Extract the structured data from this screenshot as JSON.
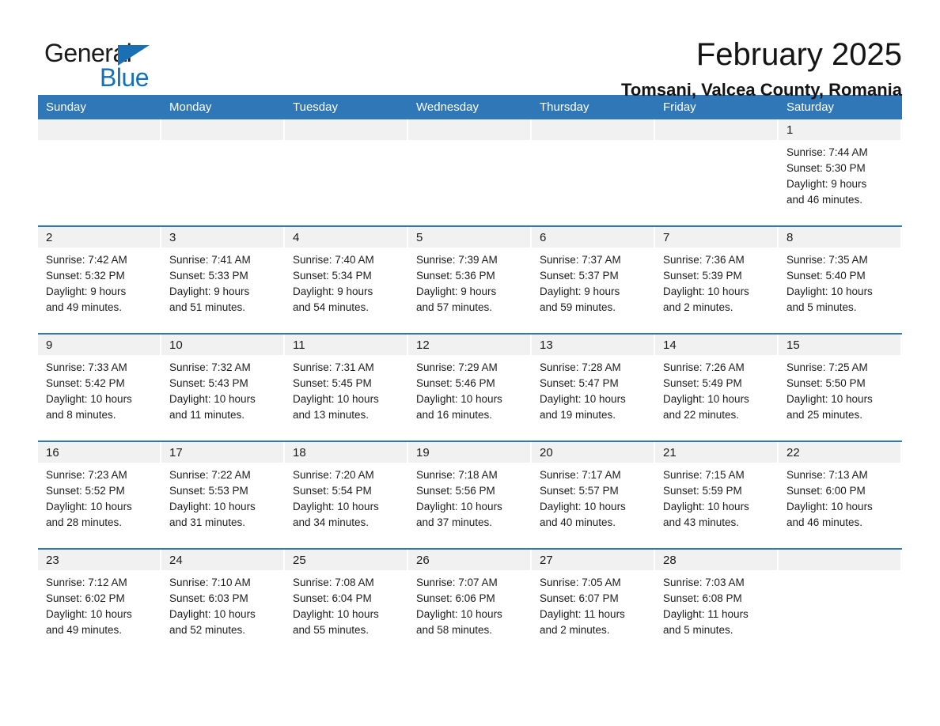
{
  "brand": {
    "name_part1": "General",
    "name_part2": "Blue",
    "triangle_icon": "triangle-icon",
    "accent_color": "#1570B8"
  },
  "header": {
    "title": "February 2025",
    "subtitle": "Tomsani, Valcea County, Romania"
  },
  "colors": {
    "header_blue": "#3077B8",
    "daynum_band": "#F1F1F1",
    "row_divider": "#3077B8"
  },
  "weekday_headers": [
    "Sunday",
    "Monday",
    "Tuesday",
    "Wednesday",
    "Thursday",
    "Friday",
    "Saturday"
  ],
  "weeks": [
    [
      {
        "day": "",
        "sunrise": "",
        "sunset": "",
        "daylight_line1": "",
        "daylight_line2": ""
      },
      {
        "day": "",
        "sunrise": "",
        "sunset": "",
        "daylight_line1": "",
        "daylight_line2": ""
      },
      {
        "day": "",
        "sunrise": "",
        "sunset": "",
        "daylight_line1": "",
        "daylight_line2": ""
      },
      {
        "day": "",
        "sunrise": "",
        "sunset": "",
        "daylight_line1": "",
        "daylight_line2": ""
      },
      {
        "day": "",
        "sunrise": "",
        "sunset": "",
        "daylight_line1": "",
        "daylight_line2": ""
      },
      {
        "day": "",
        "sunrise": "",
        "sunset": "",
        "daylight_line1": "",
        "daylight_line2": ""
      },
      {
        "day": "1",
        "sunrise": "Sunrise: 7:44 AM",
        "sunset": "Sunset: 5:30 PM",
        "daylight_line1": "Daylight: 9 hours",
        "daylight_line2": "and 46 minutes."
      }
    ],
    [
      {
        "day": "2",
        "sunrise": "Sunrise: 7:42 AM",
        "sunset": "Sunset: 5:32 PM",
        "daylight_line1": "Daylight: 9 hours",
        "daylight_line2": "and 49 minutes."
      },
      {
        "day": "3",
        "sunrise": "Sunrise: 7:41 AM",
        "sunset": "Sunset: 5:33 PM",
        "daylight_line1": "Daylight: 9 hours",
        "daylight_line2": "and 51 minutes."
      },
      {
        "day": "4",
        "sunrise": "Sunrise: 7:40 AM",
        "sunset": "Sunset: 5:34 PM",
        "daylight_line1": "Daylight: 9 hours",
        "daylight_line2": "and 54 minutes."
      },
      {
        "day": "5",
        "sunrise": "Sunrise: 7:39 AM",
        "sunset": "Sunset: 5:36 PM",
        "daylight_line1": "Daylight: 9 hours",
        "daylight_line2": "and 57 minutes."
      },
      {
        "day": "6",
        "sunrise": "Sunrise: 7:37 AM",
        "sunset": "Sunset: 5:37 PM",
        "daylight_line1": "Daylight: 9 hours",
        "daylight_line2": "and 59 minutes."
      },
      {
        "day": "7",
        "sunrise": "Sunrise: 7:36 AM",
        "sunset": "Sunset: 5:39 PM",
        "daylight_line1": "Daylight: 10 hours",
        "daylight_line2": "and 2 minutes."
      },
      {
        "day": "8",
        "sunrise": "Sunrise: 7:35 AM",
        "sunset": "Sunset: 5:40 PM",
        "daylight_line1": "Daylight: 10 hours",
        "daylight_line2": "and 5 minutes."
      }
    ],
    [
      {
        "day": "9",
        "sunrise": "Sunrise: 7:33 AM",
        "sunset": "Sunset: 5:42 PM",
        "daylight_line1": "Daylight: 10 hours",
        "daylight_line2": "and 8 minutes."
      },
      {
        "day": "10",
        "sunrise": "Sunrise: 7:32 AM",
        "sunset": "Sunset: 5:43 PM",
        "daylight_line1": "Daylight: 10 hours",
        "daylight_line2": "and 11 minutes."
      },
      {
        "day": "11",
        "sunrise": "Sunrise: 7:31 AM",
        "sunset": "Sunset: 5:45 PM",
        "daylight_line1": "Daylight: 10 hours",
        "daylight_line2": "and 13 minutes."
      },
      {
        "day": "12",
        "sunrise": "Sunrise: 7:29 AM",
        "sunset": "Sunset: 5:46 PM",
        "daylight_line1": "Daylight: 10 hours",
        "daylight_line2": "and 16 minutes."
      },
      {
        "day": "13",
        "sunrise": "Sunrise: 7:28 AM",
        "sunset": "Sunset: 5:47 PM",
        "daylight_line1": "Daylight: 10 hours",
        "daylight_line2": "and 19 minutes."
      },
      {
        "day": "14",
        "sunrise": "Sunrise: 7:26 AM",
        "sunset": "Sunset: 5:49 PM",
        "daylight_line1": "Daylight: 10 hours",
        "daylight_line2": "and 22 minutes."
      },
      {
        "day": "15",
        "sunrise": "Sunrise: 7:25 AM",
        "sunset": "Sunset: 5:50 PM",
        "daylight_line1": "Daylight: 10 hours",
        "daylight_line2": "and 25 minutes."
      }
    ],
    [
      {
        "day": "16",
        "sunrise": "Sunrise: 7:23 AM",
        "sunset": "Sunset: 5:52 PM",
        "daylight_line1": "Daylight: 10 hours",
        "daylight_line2": "and 28 minutes."
      },
      {
        "day": "17",
        "sunrise": "Sunrise: 7:22 AM",
        "sunset": "Sunset: 5:53 PM",
        "daylight_line1": "Daylight: 10 hours",
        "daylight_line2": "and 31 minutes."
      },
      {
        "day": "18",
        "sunrise": "Sunrise: 7:20 AM",
        "sunset": "Sunset: 5:54 PM",
        "daylight_line1": "Daylight: 10 hours",
        "daylight_line2": "and 34 minutes."
      },
      {
        "day": "19",
        "sunrise": "Sunrise: 7:18 AM",
        "sunset": "Sunset: 5:56 PM",
        "daylight_line1": "Daylight: 10 hours",
        "daylight_line2": "and 37 minutes."
      },
      {
        "day": "20",
        "sunrise": "Sunrise: 7:17 AM",
        "sunset": "Sunset: 5:57 PM",
        "daylight_line1": "Daylight: 10 hours",
        "daylight_line2": "and 40 minutes."
      },
      {
        "day": "21",
        "sunrise": "Sunrise: 7:15 AM",
        "sunset": "Sunset: 5:59 PM",
        "daylight_line1": "Daylight: 10 hours",
        "daylight_line2": "and 43 minutes."
      },
      {
        "day": "22",
        "sunrise": "Sunrise: 7:13 AM",
        "sunset": "Sunset: 6:00 PM",
        "daylight_line1": "Daylight: 10 hours",
        "daylight_line2": "and 46 minutes."
      }
    ],
    [
      {
        "day": "23",
        "sunrise": "Sunrise: 7:12 AM",
        "sunset": "Sunset: 6:02 PM",
        "daylight_line1": "Daylight: 10 hours",
        "daylight_line2": "and 49 minutes."
      },
      {
        "day": "24",
        "sunrise": "Sunrise: 7:10 AM",
        "sunset": "Sunset: 6:03 PM",
        "daylight_line1": "Daylight: 10 hours",
        "daylight_line2": "and 52 minutes."
      },
      {
        "day": "25",
        "sunrise": "Sunrise: 7:08 AM",
        "sunset": "Sunset: 6:04 PM",
        "daylight_line1": "Daylight: 10 hours",
        "daylight_line2": "and 55 minutes."
      },
      {
        "day": "26",
        "sunrise": "Sunrise: 7:07 AM",
        "sunset": "Sunset: 6:06 PM",
        "daylight_line1": "Daylight: 10 hours",
        "daylight_line2": "and 58 minutes."
      },
      {
        "day": "27",
        "sunrise": "Sunrise: 7:05 AM",
        "sunset": "Sunset: 6:07 PM",
        "daylight_line1": "Daylight: 11 hours",
        "daylight_line2": "and 2 minutes."
      },
      {
        "day": "28",
        "sunrise": "Sunrise: 7:03 AM",
        "sunset": "Sunset: 6:08 PM",
        "daylight_line1": "Daylight: 11 hours",
        "daylight_line2": "and 5 minutes."
      },
      {
        "day": "",
        "sunrise": "",
        "sunset": "",
        "daylight_line1": "",
        "daylight_line2": ""
      }
    ]
  ]
}
